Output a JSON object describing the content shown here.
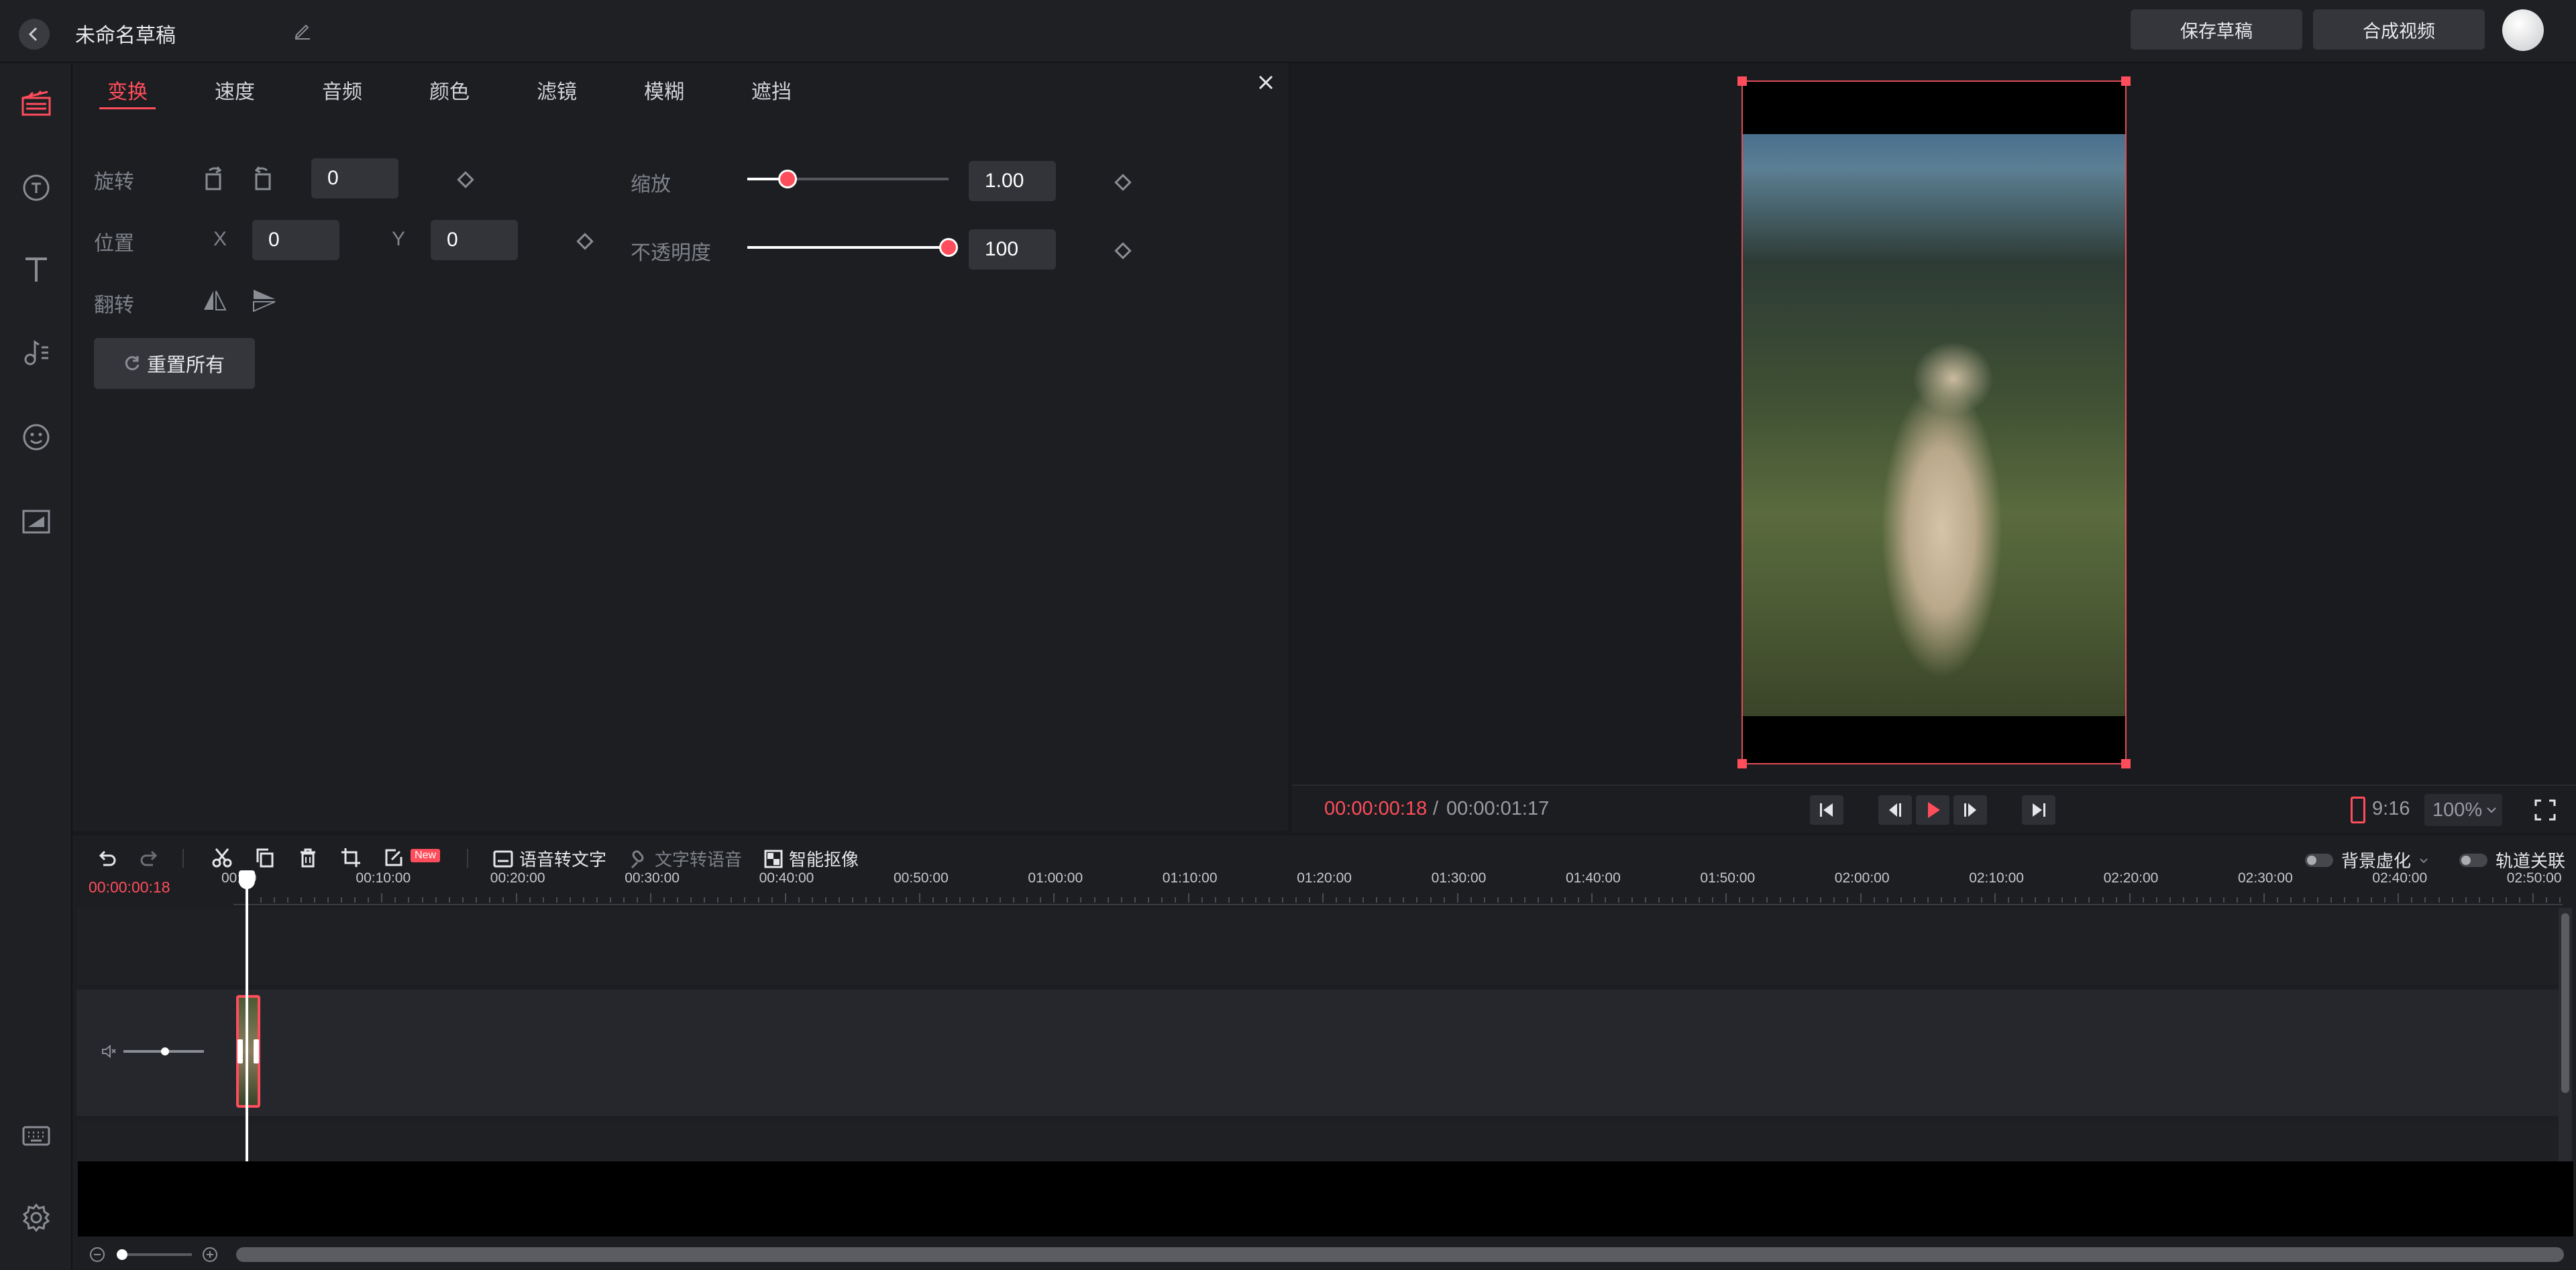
{
  "topbar": {
    "draft_title": "未命名草稿",
    "save_draft": "保存草稿",
    "export_video": "合成视频"
  },
  "rail": {
    "icons": [
      "media-icon",
      "sticker-icon",
      "text-icon",
      "audio-icon",
      "emoji-icon",
      "image-icon",
      "keyboard-icon",
      "settings-icon"
    ]
  },
  "edit_panel": {
    "tabs": [
      "变换",
      "速度",
      "音频",
      "颜色",
      "滤镜",
      "模糊",
      "遮挡"
    ],
    "active_tab": "变换",
    "rotate": {
      "label": "旋转",
      "value": "0"
    },
    "position": {
      "label": "位置",
      "x_label": "X",
      "x_value": "0",
      "y_label": "Y",
      "y_value": "0"
    },
    "flip": {
      "label": "翻转"
    },
    "reset_label": "重置所有",
    "scale": {
      "label": "缩放",
      "value": "1.00",
      "level": 0.2
    },
    "opacity": {
      "label": "不透明度",
      "value": "100",
      "level": 1.0
    }
  },
  "preview": {
    "current_time": "00:00:00:18",
    "separator": "/",
    "total_time": "00:00:01:17",
    "aspect_ratio": "9:16",
    "zoom": "100%"
  },
  "timeline": {
    "tools": {
      "speech_to_text": "语音转文字",
      "text_to_speech": "文字转语音",
      "smart_cutout": "智能抠像",
      "new_badge": "New"
    },
    "toggles": {
      "background_blur": "背景虚化",
      "track_link": "轨道关联"
    },
    "playhead_time": "00:00:00:18",
    "ticks": [
      "00:00",
      "00:10:00",
      "00:20:00",
      "00:30:00",
      "00:40:00",
      "00:50:00",
      "01:00:00",
      "01:10:00",
      "01:20:00",
      "01:30:00",
      "01:40:00",
      "01:50:00",
      "02:00:00",
      "02:10:00",
      "02:20:00",
      "02:30:00",
      "02:40:00",
      "02:50:00"
    ]
  },
  "colors": {
    "accent": "#ff4d5b",
    "background": "#18191d",
    "panel": "#1d1e22"
  }
}
